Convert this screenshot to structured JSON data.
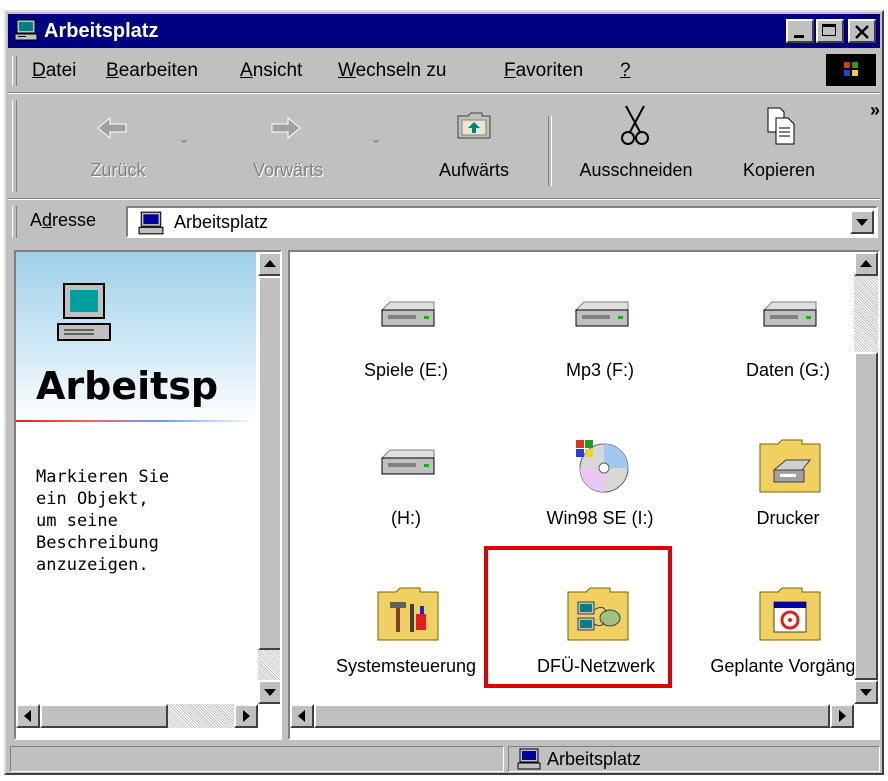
{
  "window": {
    "title": "Arbeitsplatz"
  },
  "menu": {
    "items": [
      {
        "underline": "D",
        "rest": "atei"
      },
      {
        "underline": "B",
        "rest": "earbeiten"
      },
      {
        "underline": "A",
        "rest": "nsicht"
      },
      {
        "underline": "W",
        "rest": "echseln zu"
      },
      {
        "underline": "F",
        "rest": "avoriten"
      },
      {
        "underline": "?",
        "rest": ""
      }
    ]
  },
  "toolbar": {
    "back": "Zurück",
    "forward": "Vorwärts",
    "up": "Aufwärts",
    "cut": "Ausschneiden",
    "copy": "Kopieren",
    "more": "»"
  },
  "address": {
    "label_pre": "A",
    "label_u": "d",
    "label_post": "resse",
    "value": "Arbeitsplatz"
  },
  "leftpane": {
    "title": "Arbeitsp",
    "description": "Markieren Sie\nein Objekt,\num seine\nBeschreibung\nanzuzeigen."
  },
  "items": [
    {
      "label": "Spiele (E:)",
      "icon": "drive-icon"
    },
    {
      "label": "Mp3 (F:)",
      "icon": "drive-icon"
    },
    {
      "label": "Daten (G:)",
      "icon": "drive-icon"
    },
    {
      "label": "(H:)",
      "icon": "drive-icon"
    },
    {
      "label": "Win98 SE (I:)",
      "icon": "cd-drive-icon"
    },
    {
      "label": "Drucker",
      "icon": "printer-folder-icon"
    },
    {
      "label": "Systemsteuerung",
      "icon": "control-panel-folder-icon"
    },
    {
      "label": "DFÜ-Netzwerk",
      "icon": "dialup-network-folder-icon"
    },
    {
      "label": "Geplante Vorgänge",
      "icon": "scheduled-tasks-folder-icon"
    }
  ],
  "status": {
    "location": "Arbeitsplatz"
  },
  "colors": {
    "titlebar": "#000080",
    "face": "#c0c0c0",
    "highlight_box": "#e00000"
  }
}
